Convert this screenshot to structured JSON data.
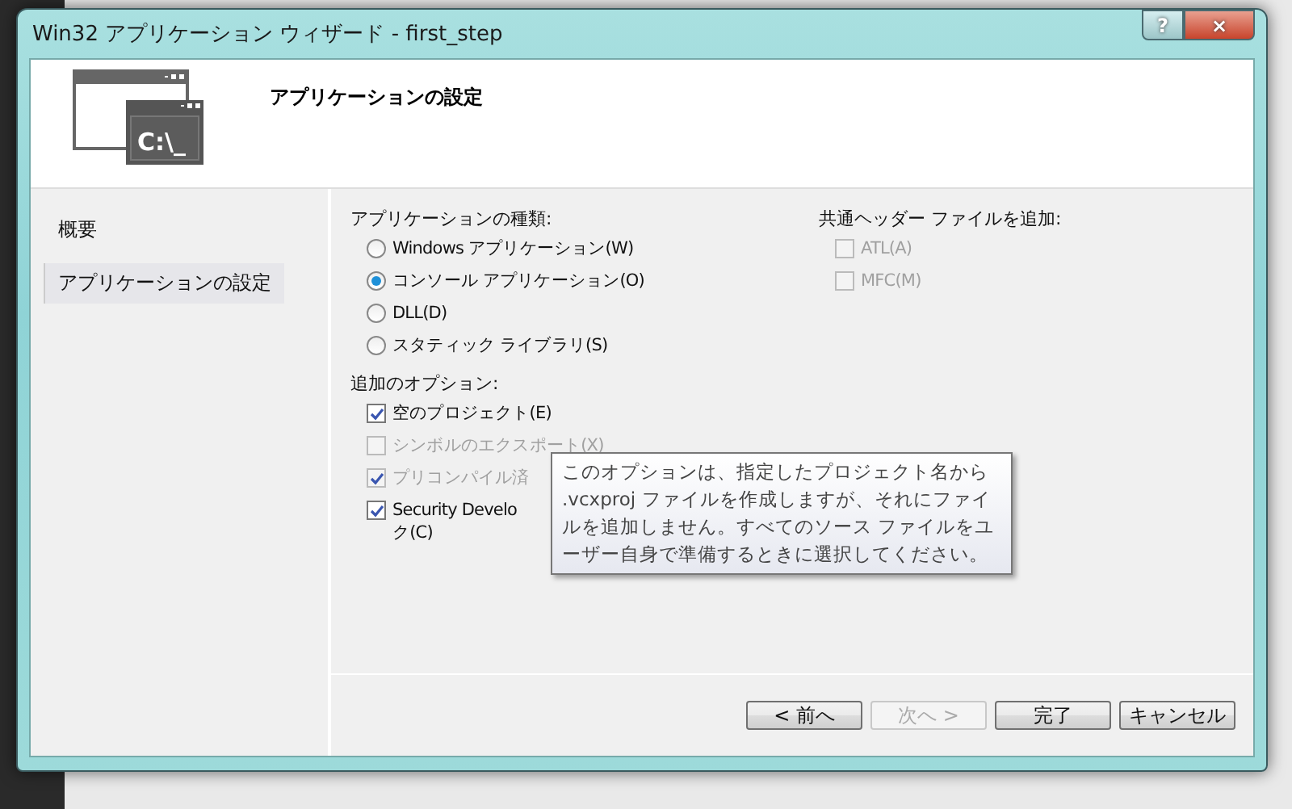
{
  "window": {
    "title": "Win32 アプリケーション ウィザード - first_step",
    "help_button": "?",
    "close_button": "×"
  },
  "header": {
    "title": "アプリケーションの設定",
    "icon_text": "C:\\_"
  },
  "sidebar": {
    "items": [
      {
        "label": "概要",
        "selected": false
      },
      {
        "label": "アプリケーションの設定",
        "selected": true
      }
    ]
  },
  "app_type": {
    "label": "アプリケーションの種類:",
    "options": [
      {
        "label": "Windows アプリケーション(W)",
        "selected": false
      },
      {
        "label": "コンソール アプリケーション(O)",
        "selected": true
      },
      {
        "label": "DLL(D)",
        "selected": false
      },
      {
        "label": "スタティック ライブラリ(S)",
        "selected": false
      }
    ]
  },
  "additional_options": {
    "label": "追加のオプション:",
    "options": [
      {
        "label": "空のプロジェクト(E)",
        "checked": true,
        "disabled": false
      },
      {
        "label": "シンボルのエクスポート(X)",
        "checked": false,
        "disabled": true
      },
      {
        "label": "プリコンパイル済",
        "checked": true,
        "disabled": true
      },
      {
        "label": "Security Develo",
        "label_cont": "ク(C)",
        "checked": true,
        "disabled": false
      }
    ]
  },
  "common_headers": {
    "label": "共通ヘッダー ファイルを追加:",
    "options": [
      {
        "label": "ATL(A)",
        "checked": false,
        "disabled": true
      },
      {
        "label": "MFC(M)",
        "checked": false,
        "disabled": true
      }
    ]
  },
  "tooltip": "このオプションは、指定したプロジェクト名から .vcxproj ファイルを作成しますが、それにファイルを追加しません。すべてのソース ファイルをユーザー自身で準備するときに選択してください。",
  "buttons": [
    {
      "label": "< 前へ",
      "disabled": false
    },
    {
      "label": "次へ >",
      "disabled": true
    },
    {
      "label": "完了",
      "disabled": false
    },
    {
      "label": "キャンセル",
      "disabled": false
    }
  ]
}
